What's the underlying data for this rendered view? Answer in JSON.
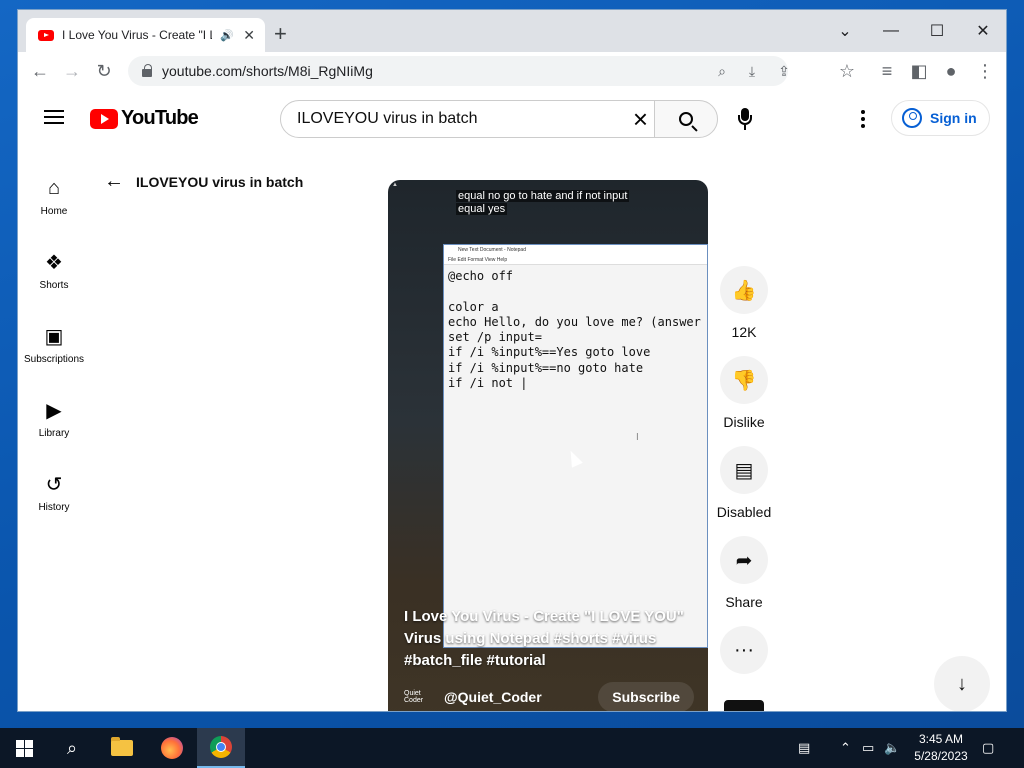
{
  "browser": {
    "tab_title": "I Love You Virus - Create \"I L",
    "new_tab": "+",
    "url": "youtube.com/shorts/M8i_RgNIiMg",
    "window_controls": {
      "chevron": "⌄",
      "minimize": "—",
      "maximize": "☐",
      "close": "✕"
    }
  },
  "youtube": {
    "logo_text": "YouTube",
    "search_value": "ILOVEYOU virus in batch",
    "sign_in": "Sign in",
    "sidebar": [
      {
        "label": "Home",
        "icon": "home-icon",
        "glyph": "⌂"
      },
      {
        "label": "Shorts",
        "icon": "shorts-icon",
        "glyph": "❖"
      },
      {
        "label": "Subscriptions",
        "icon": "subscriptions-icon",
        "glyph": "▣"
      },
      {
        "label": "Library",
        "icon": "library-icon",
        "glyph": "▶"
      },
      {
        "label": "History",
        "icon": "history-icon",
        "glyph": "↺"
      }
    ],
    "back_label": "ILOVEYOU virus in batch"
  },
  "short": {
    "caption_line1": "equal no go to hate and if not input",
    "caption_line2": "equal yes",
    "notepad_title": "New Text Document - Notepad",
    "notepad_menu": "File   Edit   Format   View   Help",
    "notepad_text": "@echo off\n\ncolor a\necho Hello, do you love me? (answer\nset /p input=\nif /i %input%==Yes goto love\nif /i %input%==no goto hate\nif /i not |",
    "title": "I Love You Virus - Create \"I LOVE YOU\" Virus using Notepad #shorts #virus #batch_file #tutorial",
    "channel_avatar_text": "Quiet Coder",
    "channel": "@Quiet_Coder",
    "subscribe": "Subscribe",
    "actions": [
      {
        "label": "12K",
        "icon": "like-icon",
        "glyph": "👍"
      },
      {
        "label": "Dislike",
        "icon": "dislike-icon",
        "glyph": "👎"
      },
      {
        "label": "Disabled",
        "icon": "comments-icon",
        "glyph": "▤"
      },
      {
        "label": "Share",
        "icon": "share-icon",
        "glyph": "➦"
      },
      {
        "label": "",
        "icon": "more-icon",
        "glyph": "···"
      }
    ]
  },
  "taskbar": {
    "time": "3:45 AM",
    "date": "5/28/2023"
  }
}
